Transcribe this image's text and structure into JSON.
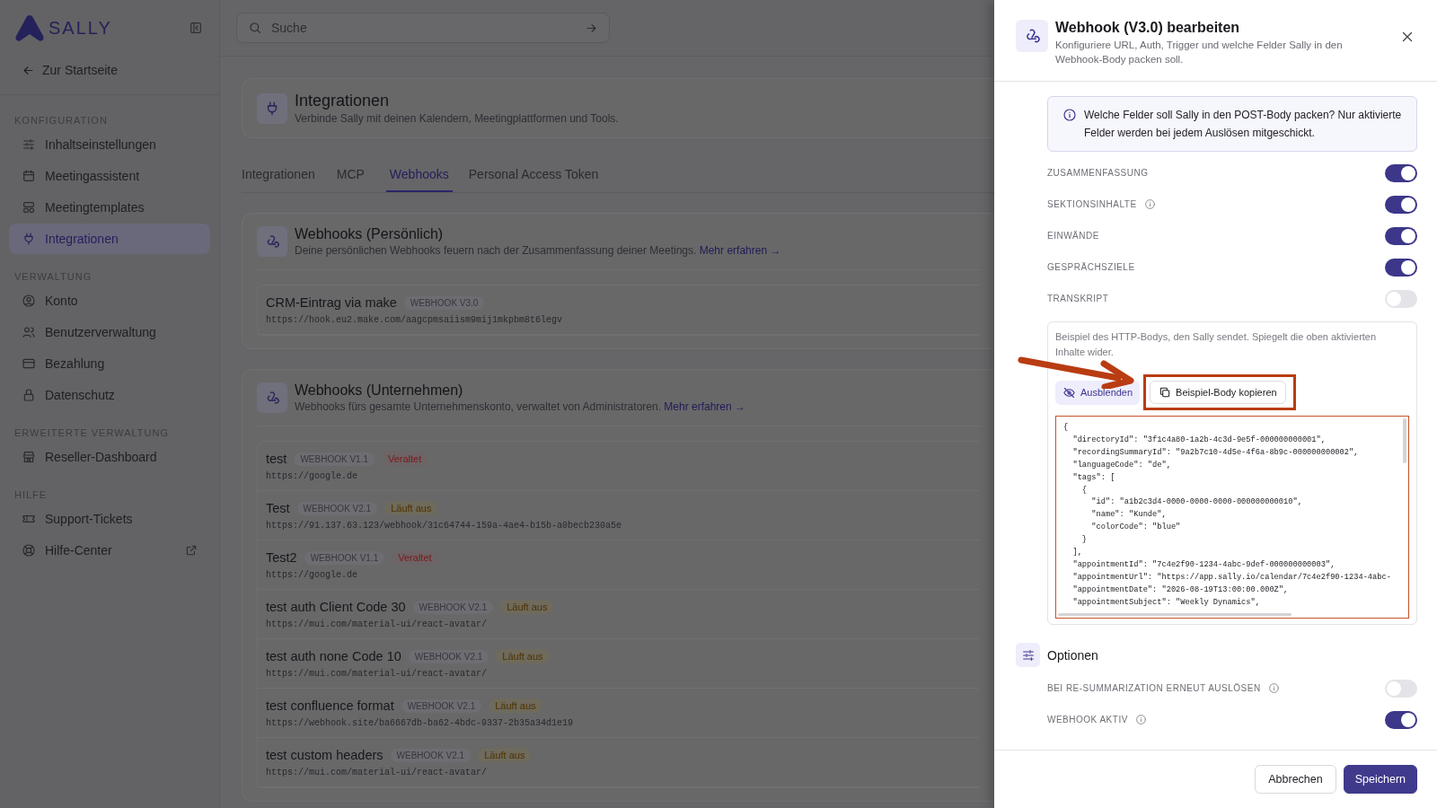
{
  "sidebar": {
    "logo": "SALLY",
    "back_link": "Zur Startseite",
    "sections": [
      {
        "title": "KONFIGURATION",
        "items": [
          {
            "label": "Inhaltseinstellungen",
            "selected": false,
            "external": false
          },
          {
            "label": "Meetingassistent",
            "selected": false,
            "external": false
          },
          {
            "label": "Meetingtemplates",
            "selected": false,
            "external": false
          },
          {
            "label": "Integrationen",
            "selected": true,
            "external": false
          }
        ]
      },
      {
        "title": "VERWALTUNG",
        "items": [
          {
            "label": "Konto",
            "selected": false,
            "external": false
          },
          {
            "label": "Benutzerverwaltung",
            "selected": false,
            "external": false
          },
          {
            "label": "Bezahlung",
            "selected": false,
            "external": false
          },
          {
            "label": "Datenschutz",
            "selected": false,
            "external": false
          }
        ]
      },
      {
        "title": "ERWEITERTE VERWALTUNG",
        "items": [
          {
            "label": "Reseller-Dashboard",
            "selected": false,
            "external": false
          }
        ]
      },
      {
        "title": "HILFE",
        "items": [
          {
            "label": "Support-Tickets",
            "selected": false,
            "external": false
          },
          {
            "label": "Hilfe-Center",
            "selected": false,
            "external": true
          }
        ]
      }
    ]
  },
  "search": {
    "placeholder": "Suche"
  },
  "page_header": {
    "title": "Integrationen",
    "subtitle": "Verbinde Sally mit deinen Kalendern, Meetingplattformen und Tools."
  },
  "tabs": [
    {
      "label": "Integrationen",
      "selected": false
    },
    {
      "label": "MCP",
      "selected": false
    },
    {
      "label": "Webhooks",
      "selected": true
    },
    {
      "label": "Personal Access Token",
      "selected": false
    }
  ],
  "webhook_groups": [
    {
      "title": "Webhooks (Persönlich)",
      "description": "Deine persönlichen Webhooks feuern nach der Zusammenfassung deiner Meetings.",
      "link": "Mehr erfahren →",
      "webhooks": [
        {
          "name": "CRM-Eintrag via make",
          "version": "WEBHOOK V3.0",
          "url": "https://hook.eu2.make.com/aagcpmsaiism9mij1mkpbm8t6legv"
        }
      ]
    },
    {
      "title": "Webhooks (Unternehmen)",
      "description": "Webhooks fürs gesamte Unternehmenskonto, verwaltet von Administratoren.",
      "link": "Mehr erfahren →",
      "webhooks": [
        {
          "name": "test",
          "version": "WEBHOOK V1.1",
          "status": {
            "text": "Veraltet",
            "kind": "deprecated"
          },
          "url": "https://google.de"
        },
        {
          "name": "Test",
          "version": "WEBHOOK V2.1",
          "status": {
            "text": "Läuft aus",
            "kind": "expiring"
          },
          "url": "https://91.137.63.123/webhook/31c64744-159a-4ae4-b15b-a0becb230a5e"
        },
        {
          "name": "Test2",
          "version": "WEBHOOK V1.1",
          "status": {
            "text": "Veraltet",
            "kind": "deprecated"
          },
          "url": "https://google.de"
        },
        {
          "name": "test auth Client Code 30",
          "version": "WEBHOOK V2.1",
          "status": {
            "text": "Läuft aus",
            "kind": "expiring"
          },
          "url": "https://mui.com/material-ui/react-avatar/"
        },
        {
          "name": "test auth none Code 10",
          "version": "WEBHOOK V2.1",
          "status": {
            "text": "Läuft aus",
            "kind": "expiring"
          },
          "url": "https://mui.com/material-ui/react-avatar/"
        },
        {
          "name": "test confluence format",
          "version": "WEBHOOK V2.1",
          "status": {
            "text": "Läuft aus",
            "kind": "expiring"
          },
          "url": "https://webhook.site/ba6667db-ba62-4bdc-9337-2b35a34d1e19"
        },
        {
          "name": "test custom headers",
          "version": "WEBHOOK V2.1",
          "status": {
            "text": "Läuft aus",
            "kind": "expiring"
          },
          "url": "https://mui.com/material-ui/react-avatar/"
        }
      ]
    }
  ],
  "drawer": {
    "title": "Webhook (V3.0) bearbeiten",
    "subtitle": "Konfiguriere URL, Auth, Trigger und welche Felder Sally in den Webhook-Body packen soll.",
    "info": "Welche Felder soll Sally in den POST-Body packen? Nur aktivierte Felder werden bei jedem Auslösen mitgeschickt.",
    "fields": [
      {
        "label": "ZUSAMMENFASSUNG",
        "on": true
      },
      {
        "label": "SEKTIONSINHALTE",
        "info": true,
        "on": true
      },
      {
        "label": "EINWÄNDE",
        "on": true
      },
      {
        "label": "GESPRÄCHSZIELE",
        "on": true
      },
      {
        "label": "TRANSKRIPT",
        "on": false
      }
    ],
    "example": {
      "hint": "Beispiel des HTTP-Bodys, den Sally sendet. Spiegelt die oben aktivierten Inhalte wider.",
      "hide_button": "Ausblenden",
      "copy_button": "Beispiel-Body kopieren",
      "code_lines": [
        "{",
        "  \"directoryId\": \"3f1c4a80-1a2b-4c3d-9e5f-000000000001\",",
        "  \"recordingSummaryId\": \"9a2b7c10-4d5e-4f6a-8b9c-000000000002\",",
        "  \"languageCode\": \"de\",",
        "  \"tags\": [",
        "    {",
        "      \"id\": \"a1b2c3d4-0000-0000-0000-000000000010\",",
        "      \"name\": \"Kunde\",",
        "      \"colorCode\": \"blue\"",
        "    }",
        "  ],",
        "  \"appointmentId\": \"7c4e2f90-1234-4abc-9def-000000000003\",",
        "  \"appointmentUrl\": \"https://app.sally.io/calendar/7c4e2f90-1234-4abc-",
        "  \"appointmentDate\": \"2026-08-19T13:00:00.000Z\",",
        "  \"appointmentSubject\": \"Weekly Dynamics\","
      ]
    },
    "options_title": "Optionen",
    "options": [
      {
        "label": "BEI RE-SUMMARIZATION ERNEUT AUSLÖSEN",
        "info": true,
        "on": false
      },
      {
        "label": "WEBHOOK AKTIV",
        "info": true,
        "on": true
      }
    ],
    "cancel_button": "Abbrechen",
    "save_button": "Speichern"
  }
}
